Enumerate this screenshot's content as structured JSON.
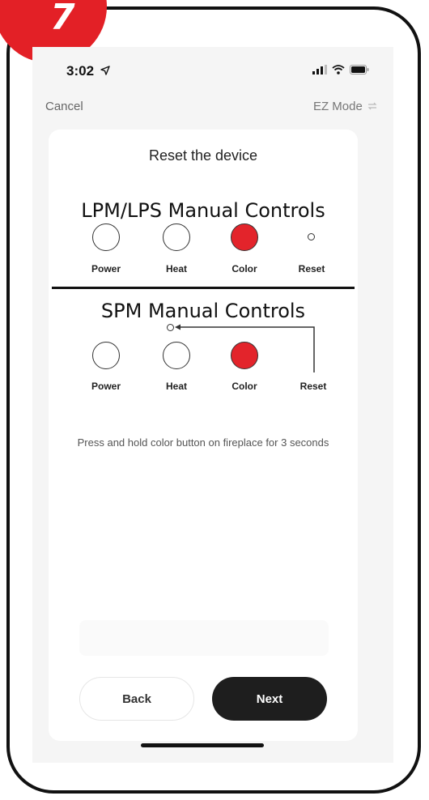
{
  "step_badge": {
    "number": "7",
    "color": "#e32026"
  },
  "status_bar": {
    "time": "3:02",
    "icons": [
      "location-arrow-icon",
      "signal-icon",
      "wifi-icon",
      "battery-icon"
    ]
  },
  "nav": {
    "cancel_label": "Cancel",
    "mode_label": "EZ Mode",
    "mode_icon": "swap-icon"
  },
  "card": {
    "title": "Reset the device",
    "lpm_section": {
      "title": "LPM/LPS Manual Controls",
      "buttons": [
        {
          "label": "Power",
          "state": "off"
        },
        {
          "label": "Heat",
          "state": "off"
        },
        {
          "label": "Color",
          "state": "active",
          "color": "#e3242b"
        },
        {
          "label": "Reset",
          "state": "pinhole"
        }
      ]
    },
    "spm_section": {
      "title": "SPM Manual Controls",
      "buttons": [
        {
          "label": "Power",
          "state": "off"
        },
        {
          "label": "Heat",
          "state": "off"
        },
        {
          "label": "Color",
          "state": "active",
          "color": "#e3242b"
        },
        {
          "label": "Reset",
          "state": "pinhole"
        }
      ]
    },
    "instruction": "Press and hold color button on fireplace for 3 seconds"
  },
  "actions": {
    "back_label": "Back",
    "next_label": "Next"
  }
}
